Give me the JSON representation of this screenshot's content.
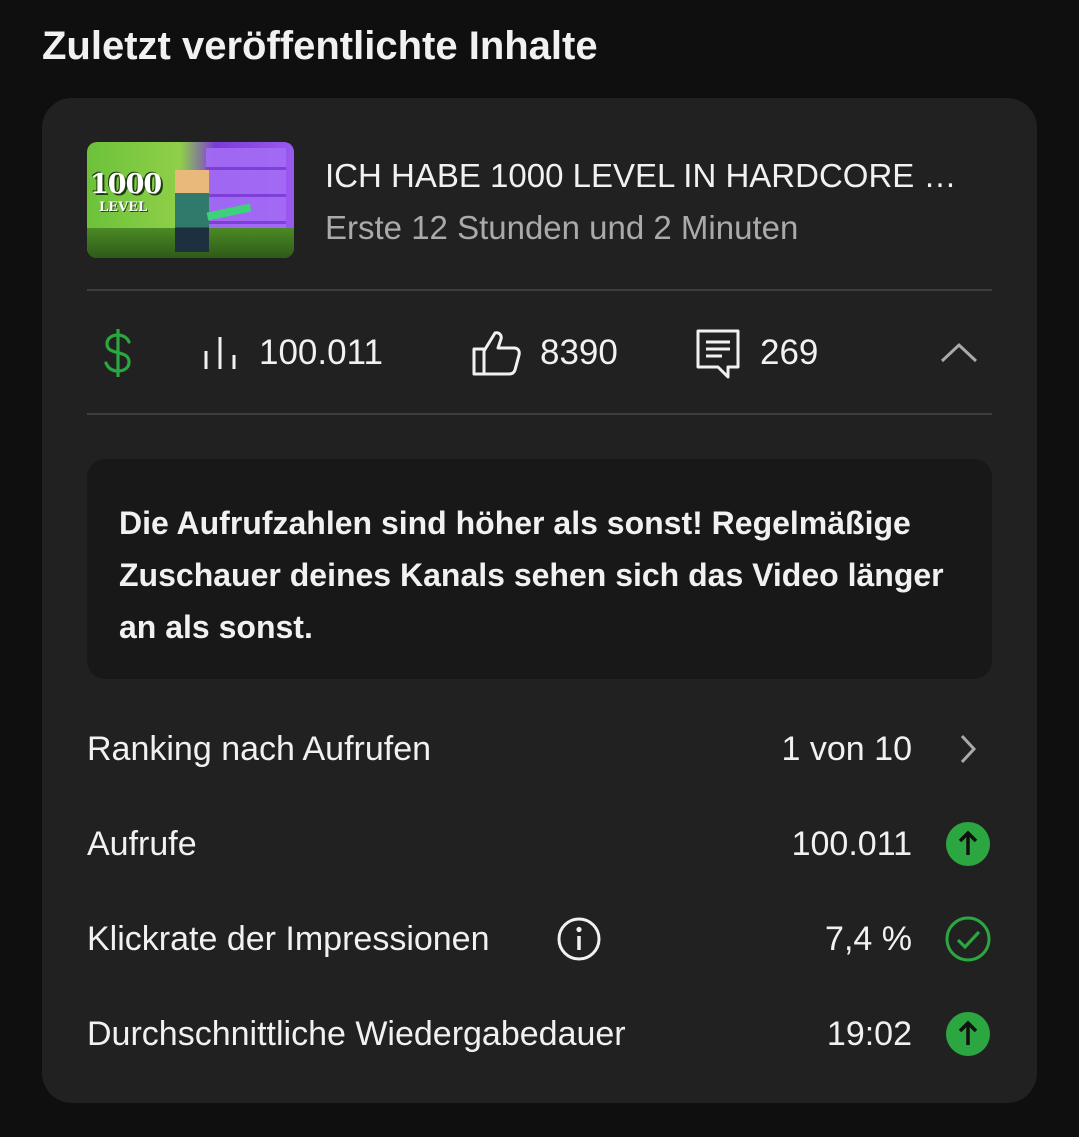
{
  "section": {
    "title": "Zuletzt veröffentlichte Inhalte"
  },
  "video": {
    "thumbnail": {
      "overlay_big": "1000",
      "overlay_small": "LEVEL"
    },
    "title": "ICH HABE 1000 LEVEL IN HARDCORE …",
    "subtitle": "Erste 12 Stunden und 2 Minuten"
  },
  "stats": {
    "monetization_icon": "dollar-icon",
    "views": "100.011",
    "likes": "8390",
    "comments": "269",
    "collapse_icon": "chevron-up-icon"
  },
  "notice": {
    "text": "Die Aufrufzahlen sind höher als sonst! Regelmäßige Zuschauer deines Kanals sehen sich das Video länger an als sonst."
  },
  "metrics": [
    {
      "label": "Ranking nach Aufrufen",
      "value": "1 von 10",
      "end_icon": "chevron-right-icon"
    },
    {
      "label": "Aufrufe",
      "value": "100.011",
      "end_icon": "arrow-up-circle-icon"
    },
    {
      "label": "Klickrate der Impressionen",
      "value": "7,4 %",
      "end_icon": "check-circle-icon",
      "has_info": true
    },
    {
      "label": "Durchschnittliche Wiedergabedauer",
      "value": "19:02",
      "end_icon": "arrow-up-circle-icon"
    }
  ],
  "colors": {
    "background": "#0f0f0f",
    "card": "#212121",
    "notice": "#181818",
    "positive_green": "#2ba640",
    "monetization_green": "#2ba640",
    "secondary_text": "#aaaaaa"
  }
}
